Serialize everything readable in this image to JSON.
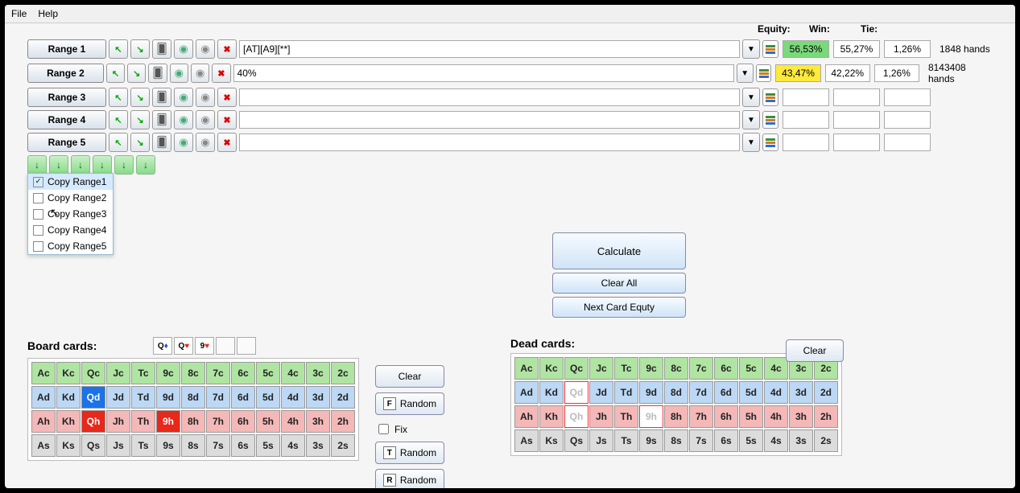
{
  "menu": {
    "file": "File",
    "help": "Help"
  },
  "header": {
    "equity": "Equity:",
    "win": "Win:",
    "tie": "Tie:"
  },
  "ranges": [
    {
      "label": "Range 1",
      "text": "[AT][A9][**]",
      "equity": "56,53%",
      "win": "55,27%",
      "tie": "1,26%",
      "hands": "1848 hands",
      "eqClass": "res-green"
    },
    {
      "label": "Range 2",
      "text": "40%",
      "equity": "43,47%",
      "win": "42,22%",
      "tie": "1,26%",
      "hands": "8143408 hands",
      "eqClass": "res-yellow"
    },
    {
      "label": "Range 3",
      "text": "",
      "equity": "",
      "win": "",
      "tie": "",
      "hands": "",
      "eqClass": ""
    },
    {
      "label": "Range 4",
      "text": "",
      "equity": "",
      "win": "",
      "tie": "",
      "hands": "",
      "eqClass": ""
    },
    {
      "label": "Range 5",
      "text": "",
      "equity": "",
      "win": "",
      "tie": "",
      "hands": "",
      "eqClass": ""
    }
  ],
  "copyMenu": [
    {
      "label": "Copy Range1",
      "checked": true
    },
    {
      "label": "Copy Range2",
      "checked": false
    },
    {
      "label": "Copy Range3",
      "checked": false
    },
    {
      "label": "Copy Range4",
      "checked": false
    },
    {
      "label": "Copy Range5",
      "checked": false
    }
  ],
  "actions": {
    "calculate": "Calculate",
    "clearAll": "Clear All",
    "nextEq": "Next Card Equty"
  },
  "board": {
    "label": "Board cards:",
    "mini": [
      {
        "rank": "Q",
        "suit": "d"
      },
      {
        "rank": "Q",
        "suit": "h"
      },
      {
        "rank": "9",
        "suit": "h"
      }
    ]
  },
  "dead": {
    "label": "Dead cards:"
  },
  "clear": "Clear",
  "random": "Random",
  "fix": "Fix",
  "ranks": [
    "A",
    "K",
    "Q",
    "J",
    "T",
    "9",
    "8",
    "7",
    "6",
    "5",
    "4",
    "3",
    "2"
  ],
  "suits": [
    "c",
    "d",
    "h",
    "s"
  ],
  "boardSelected": [
    "Qd",
    "Qh",
    "9h"
  ]
}
